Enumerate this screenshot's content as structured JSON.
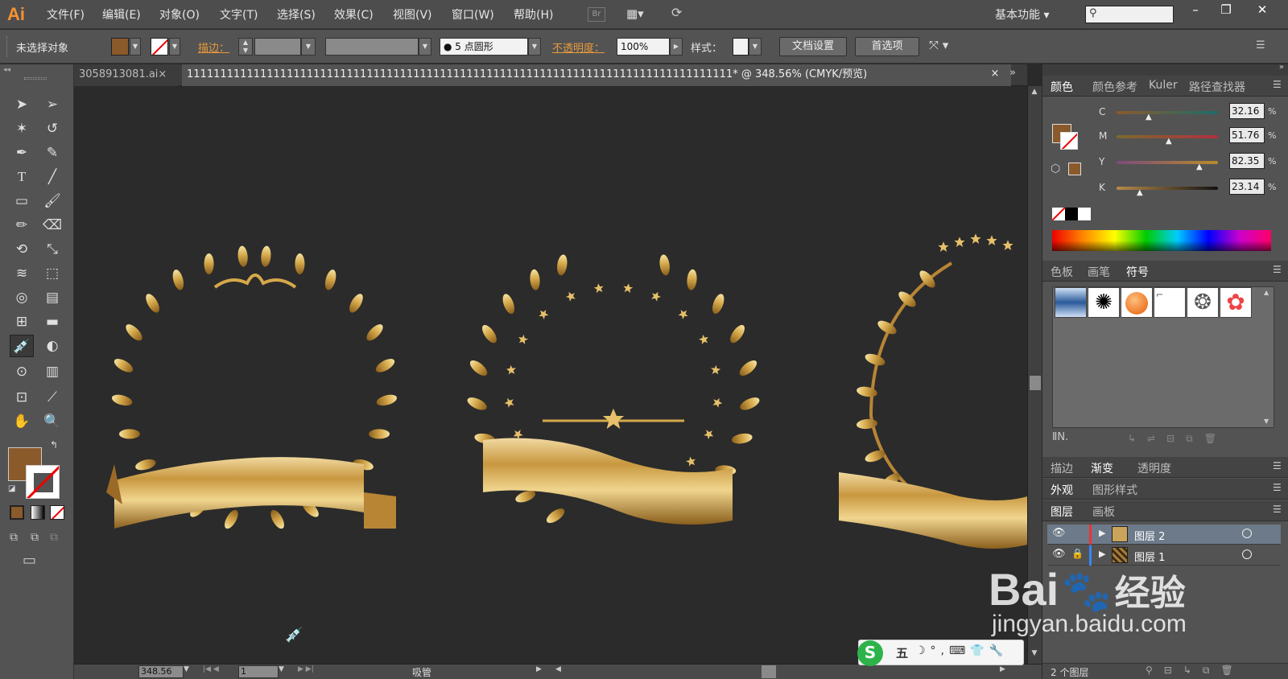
{
  "menubar": {
    "logo": "Ai",
    "menus": [
      "文件(F)",
      "编辑(E)",
      "对象(O)",
      "文字(T)",
      "选择(S)",
      "效果(C)",
      "视图(V)",
      "窗口(W)",
      "帮助(H)"
    ],
    "bridge": "Br",
    "workspace": "基本功能",
    "window_buttons": [
      "–",
      "❐",
      "✕"
    ]
  },
  "control": {
    "selection": "未选择对象",
    "fill_color": "#8b5a2b",
    "stroke_label": "描边：",
    "brush": "5 点圆形",
    "opacity_label": "不透明度：",
    "opacity_value": "100%",
    "style_label": "样式：",
    "doc_setup": "文档设置",
    "prefs": "首选项"
  },
  "tabs": [
    {
      "label": "3058913081.ai",
      "close": "×"
    },
    {
      "label": "1111111111111111111111111111111111111111111111111111111111111111111111111111111111* @ 348.56% (CMYK/预览)",
      "close": "×"
    }
  ],
  "color_panel": {
    "tabs": [
      "颜色",
      "颜色参考",
      "Kuler",
      "路径查找器"
    ],
    "channels": [
      {
        "name": "C",
        "value": "32.16",
        "pos": 0.32
      },
      {
        "name": "M",
        "value": "51.76",
        "pos": 0.52
      },
      {
        "name": "Y",
        "value": "82.35",
        "pos": 0.82
      },
      {
        "name": "K",
        "value": "23.14",
        "pos": 0.23
      }
    ],
    "unit": "%"
  },
  "symbol_panel": {
    "tabs": [
      "色板",
      "画笔",
      "符号"
    ]
  },
  "panel_tabs2": [
    "描边",
    "渐变",
    "透明度"
  ],
  "panel_tabs3": [
    "外观",
    "图形样式"
  ],
  "layers_panel": {
    "tabs": [
      "图层",
      "画板"
    ],
    "layers": [
      {
        "name": "图层 2"
      },
      {
        "name": "图层 1"
      }
    ],
    "count": "2 个图层"
  },
  "status": {
    "zoom": "348.56",
    "page": "1",
    "tool": "吸管"
  },
  "ime": {
    "mode": "五"
  },
  "watermark": {
    "brand": "Bai",
    "cn": "经验",
    "url": "jingyan.baidu.com"
  }
}
